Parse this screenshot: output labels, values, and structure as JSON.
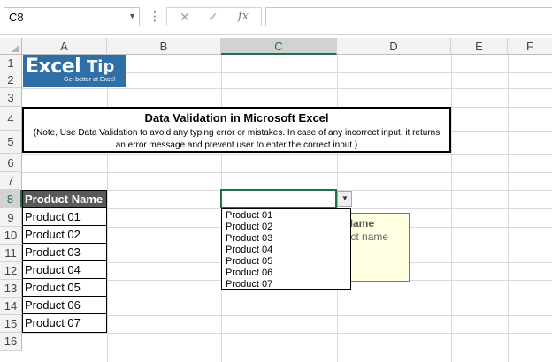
{
  "formula_bar": {
    "name_box": "C8",
    "dots": "⋮",
    "cancel": "✕",
    "enter": "✓",
    "fx": "fx",
    "formula": ""
  },
  "columns": [
    "A",
    "B",
    "C",
    "D",
    "E",
    "F"
  ],
  "rows": [
    "1",
    "2",
    "3",
    "4",
    "5",
    "6",
    "7",
    "8",
    "9",
    "10",
    "11",
    "12",
    "13",
    "14",
    "15",
    "16"
  ],
  "logo": {
    "excel": "Excel",
    "tip": "Tip",
    "tagline": "Get better at Excel"
  },
  "title_box": {
    "heading": "Data Validation in Microsoft Excel",
    "note": "(Note, Use Data Validation to avoid any typing error or mistakes. In case of any incorrect input, it returns an error message and prevent user to enter the correct input.)"
  },
  "product_table": {
    "header": "Product Name",
    "items": [
      "Product 01",
      "Product 02",
      "Product 03",
      "Product 04",
      "Product 05",
      "Product 06",
      "Product 07"
    ]
  },
  "active_cell": {
    "ref": "C8",
    "value": ""
  },
  "input_message": {
    "title": "t Name",
    "message": "duct name"
  },
  "dropdown": {
    "options": [
      "Product 01",
      "Product 02",
      "Product 03",
      "Product 04",
      "Product 05",
      "Product 06",
      "Product 07"
    ]
  },
  "colors": {
    "accent": "#217346",
    "header_fill": "#595959",
    "logo_blue": "#2f6fa8",
    "tooltip": "#ffffe1"
  }
}
